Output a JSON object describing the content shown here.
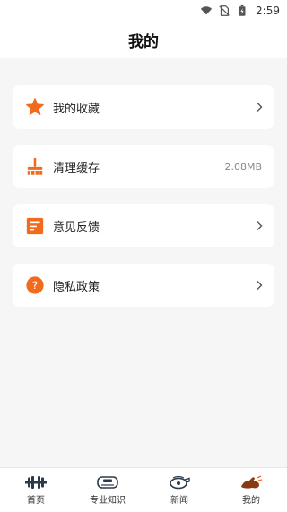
{
  "status_bar": {
    "time": "2:59",
    "icons": [
      "wifi-icon",
      "no-sim-icon",
      "battery-charging-icon"
    ]
  },
  "header": {
    "title": "我的"
  },
  "menu": [
    {
      "id": "favorites",
      "icon": "star-icon",
      "label": "我的收藏",
      "value": "",
      "chevron": true
    },
    {
      "id": "clear-cache",
      "icon": "broom-icon",
      "label": "清理缓存",
      "value": "2.08MB",
      "chevron": false
    },
    {
      "id": "feedback",
      "icon": "document-icon",
      "label": "意见反馈",
      "value": "",
      "chevron": true
    },
    {
      "id": "privacy",
      "icon": "question-circle-icon",
      "label": "隐私政策",
      "value": "",
      "chevron": true
    }
  ],
  "bottom_nav": [
    {
      "id": "home",
      "icon": "dumbbell-icon",
      "label": "首页",
      "active": false
    },
    {
      "id": "knowledge",
      "icon": "scale-icon",
      "label": "专业知识",
      "active": false
    },
    {
      "id": "news",
      "icon": "whistle-icon",
      "label": "新闻",
      "active": false
    },
    {
      "id": "me",
      "icon": "muscle-arm-icon",
      "label": "我的",
      "active": true
    }
  ],
  "colors": {
    "accent": "#f26b1d",
    "background": "#f6f6f6",
    "card": "#ffffff",
    "text": "#222222",
    "muted": "#888888"
  }
}
